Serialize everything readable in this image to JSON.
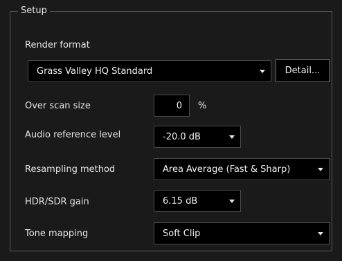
{
  "group": {
    "title": "Setup"
  },
  "render_format": {
    "label": "Render format",
    "value": "Grass Valley HQ Standard",
    "detail_button": "Detail..."
  },
  "overscan": {
    "label": "Over scan size",
    "value": "0",
    "unit": "%"
  },
  "audio_reference": {
    "label": "Audio reference level",
    "value": "-20.0 dB"
  },
  "resampling": {
    "label": "Resampling method",
    "value": "Area Average (Fast & Sharp)"
  },
  "hdr_sdr_gain": {
    "label": "HDR/SDR gain",
    "value": "6.15 dB"
  },
  "tone_mapping": {
    "label": "Tone mapping",
    "value": "Soft Clip"
  },
  "colors": {
    "background": "#1a1a1a",
    "field_background": "#000000",
    "border": "#5a5a5a",
    "text": "#e6e6e6"
  }
}
